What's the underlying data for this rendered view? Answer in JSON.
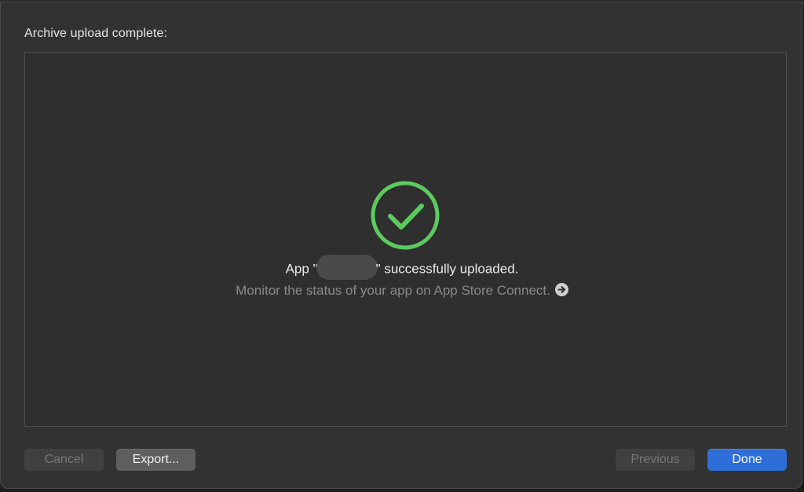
{
  "dialog": {
    "title": "Archive upload complete:"
  },
  "status": {
    "icon": "checkmark-circle-icon",
    "message_prefix": "App \"",
    "app_name": "",
    "message_suffix": "\" successfully uploaded.",
    "monitor_text": "Monitor the status of your app on App Store Connect.",
    "monitor_link_icon": "arrow-right-circle-icon"
  },
  "buttons": {
    "cancel": "Cancel",
    "export": "Export...",
    "previous": "Previous",
    "done": "Done"
  },
  "colors": {
    "success": "#5ccb5f",
    "primary": "#2d6ed9",
    "background": "#323232"
  }
}
